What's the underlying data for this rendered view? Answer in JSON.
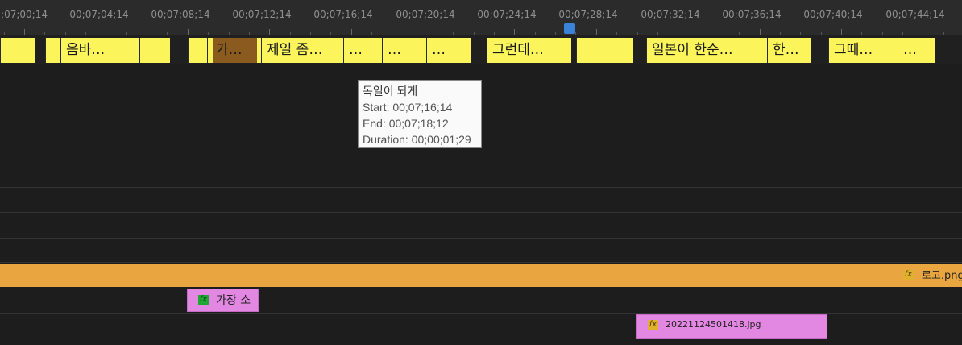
{
  "ruler": {
    "labels": [
      ";07;00;14",
      "00;07;04;14",
      "00;07;08;14",
      "00;07;12;14",
      "00;07;16;14",
      "00;07;20;14",
      "00;07;24;14",
      "00;07;28;14",
      "00;07;32;14",
      "00;07;36;14",
      "00;07;40;14",
      "00;07;44;14"
    ]
  },
  "captions": [
    {
      "text": ""
    },
    {
      "text": ""
    },
    {
      "text": "음바…"
    },
    {
      "text": ""
    },
    {
      "text": ""
    },
    {
      "text": "가…"
    },
    {
      "text": "제일 좀…"
    },
    {
      "text": "…"
    },
    {
      "text": "…"
    },
    {
      "text": "…"
    },
    {
      "text": "그런데…"
    },
    {
      "text": ""
    },
    {
      "text": ""
    },
    {
      "text": "일본이 한순…"
    },
    {
      "text": "한…"
    },
    {
      "text": "그때…"
    },
    {
      "text": "…"
    }
  ],
  "tooltip": {
    "title": "독일이 되게",
    "start": "Start: 00;07;16;14",
    "end": "End: 00;07;18;12",
    "duration": "Duration: 00;00;01;29"
  },
  "clips": {
    "logo_label": "로고.png",
    "pink_small_label": "가장 소",
    "pink_large_label": "20221124501418.jpg",
    "fx": "fx"
  },
  "colors": {
    "caption": "#fbf55b",
    "selected_caption": "#8a5a1e",
    "orange_clip": "#e9a53f",
    "pink_clip": "#e287e2",
    "playhead": "#3b83d9"
  }
}
